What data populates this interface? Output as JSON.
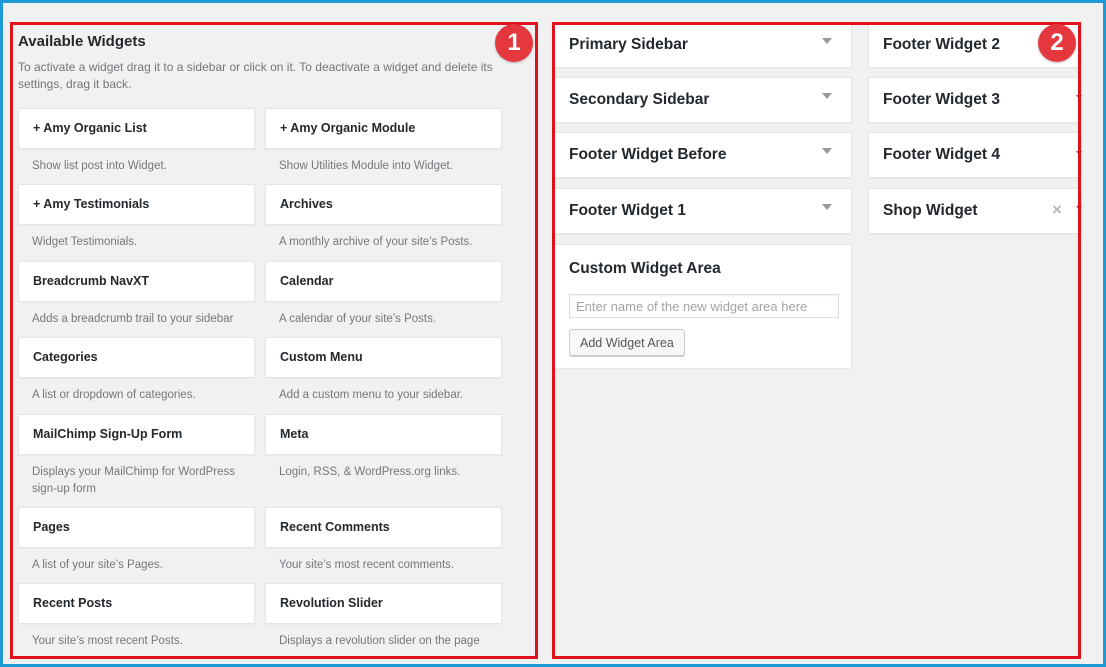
{
  "available": {
    "title": "Available Widgets",
    "description": "To activate a widget drag it to a sidebar or click on it. To deactivate a widget and delete its settings, drag it back.",
    "widgets": [
      {
        "name": "+ Amy Organic List",
        "desc": "Show list post into Widget."
      },
      {
        "name": "+ Amy Organic Module",
        "desc": "Show Utilities Module into Widget."
      },
      {
        "name": "+ Amy Testimonials",
        "desc": "Widget Testimonials."
      },
      {
        "name": "Archives",
        "desc": "A monthly archive of your site’s Posts."
      },
      {
        "name": "Breadcrumb NavXT",
        "desc": "Adds a breadcrumb trail to your sidebar"
      },
      {
        "name": "Calendar",
        "desc": "A calendar of your site’s Posts."
      },
      {
        "name": "Categories",
        "desc": "A list or dropdown of categories."
      },
      {
        "name": "Custom Menu",
        "desc": "Add a custom menu to your sidebar."
      },
      {
        "name": "MailChimp Sign-Up Form",
        "desc": "Displays your MailChimp for WordPress sign-up form"
      },
      {
        "name": "Meta",
        "desc": "Login, RSS, & WordPress.org links."
      },
      {
        "name": "Pages",
        "desc": "A list of your site’s Pages."
      },
      {
        "name": "Recent Comments",
        "desc": "Your site’s most recent comments."
      },
      {
        "name": "Recent Posts",
        "desc": "Your site’s most recent Posts."
      },
      {
        "name": "Revolution Slider",
        "desc": "Displays a revolution slider on the page"
      }
    ]
  },
  "sidebars": {
    "left": [
      "Primary Sidebar",
      "Secondary Sidebar",
      "Footer Widget Before",
      "Footer Widget 1"
    ],
    "right": [
      "Footer Widget 2",
      "Footer Widget 3",
      "Footer Widget 4",
      "Shop Widget"
    ],
    "close_icon": "×"
  },
  "custom_area": {
    "title": "Custom Widget Area",
    "placeholder": "Enter name of the new widget area here",
    "button": "Add Widget Area"
  },
  "badges": {
    "one": "1",
    "two": "2"
  },
  "colors": {
    "frame": "#1e9bd7",
    "highlight": "#e0131d",
    "badge": "#e5383e"
  }
}
